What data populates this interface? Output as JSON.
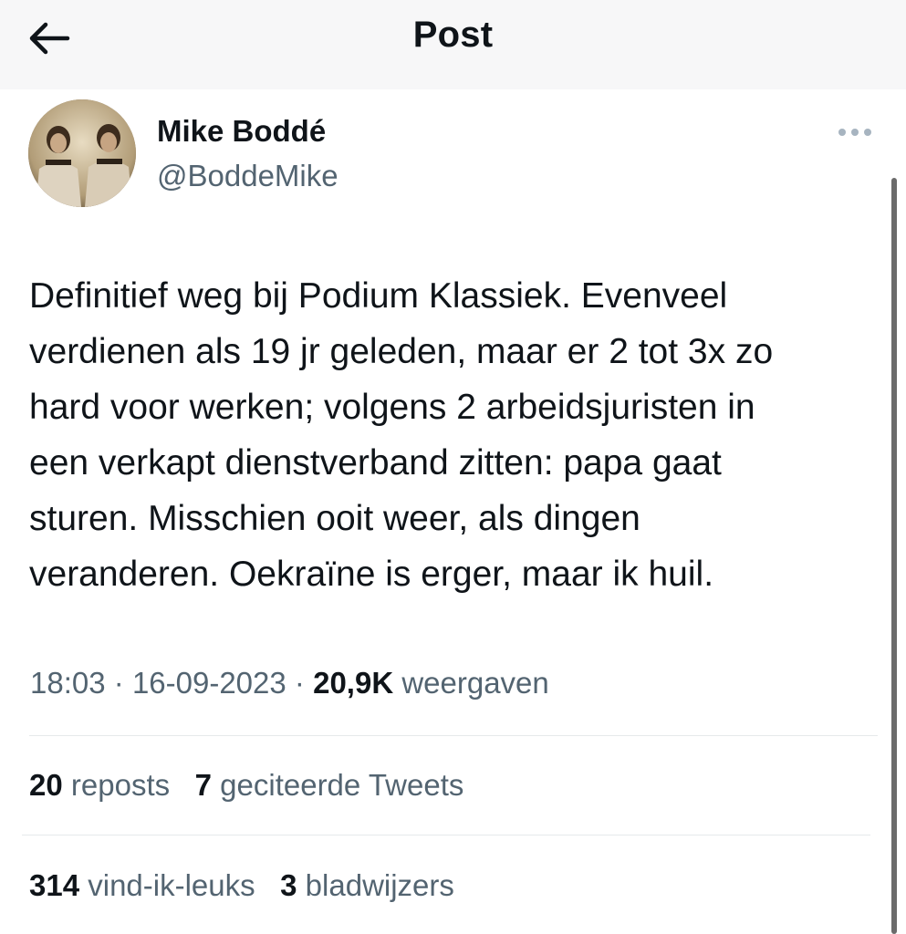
{
  "header": {
    "back_icon": "arrow-left-icon",
    "title": "Post"
  },
  "author": {
    "name": "Mike Boddé",
    "handle": "@BoddeMike"
  },
  "more_icon": "more-horizontal-icon",
  "tweet": {
    "text": "Definitief weg bij Podium Klassiek. Evenveel\nverdienen als 19 jr geleden, maar er 2 tot 3x zo\nhard voor werken; volgens 2 arbeidsjuristen in\neen verkapt dienstverband zitten: papa gaat\nsturen. Misschien ooit weer, als dingen\nveranderen. Oekraïne is erger, maar ik huil."
  },
  "meta": {
    "time": "18:03",
    "separator": "·",
    "date": "16-09-2023",
    "views_count": "20,9K",
    "views_label": "weergaven"
  },
  "stats": {
    "reposts_count": "20",
    "reposts_label": "reposts",
    "quotes_count": "7",
    "quotes_label": "geciteerde Tweets",
    "likes_count": "314",
    "likes_label": "vind-ik-leuks",
    "bookmarks_count": "3",
    "bookmarks_label": "bladwijzers"
  },
  "colors": {
    "text_primary": "#0f1419",
    "text_secondary": "#536471",
    "header_bg": "#f7f7f8",
    "divider": "#e6e9eb",
    "more_dots": "#a7b4c0"
  }
}
